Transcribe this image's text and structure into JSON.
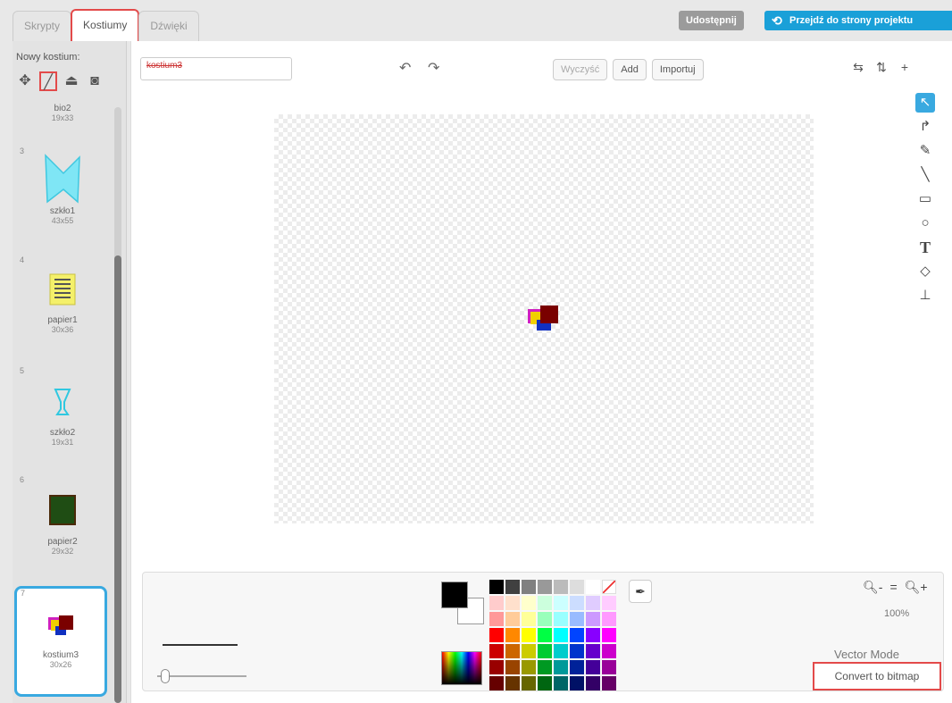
{
  "tabs": [
    {
      "label": "Skrypty"
    },
    {
      "label": "Kostiumy"
    },
    {
      "label": "Dźwięki"
    }
  ],
  "header": {
    "share_label": "Udostępnij",
    "project_page_label": "Przejdź do strony projektu",
    "project_page_icon": "sync-arrows-icon"
  },
  "sidebar": {
    "new_costume_label": "Nowy kostium:",
    "tools": [
      {
        "icon": "paintbrush-icon"
      },
      {
        "icon": "paint-new-icon"
      },
      {
        "icon": "upload-icon"
      },
      {
        "icon": "camera-icon"
      }
    ],
    "costumes": [
      {
        "num": "",
        "name": "bio2",
        "size": "19x33"
      },
      {
        "num": "3",
        "name": "szkło1",
        "size": "43x55"
      },
      {
        "num": "4",
        "name": "papier1",
        "size": "30x36"
      },
      {
        "num": "5",
        "name": "szkło2",
        "size": "19x31"
      },
      {
        "num": "6",
        "name": "papier2",
        "size": "29x32"
      },
      {
        "num": "7",
        "name": "kostium3",
        "size": "30x26"
      }
    ]
  },
  "editor": {
    "costume_name": "kostium3",
    "clear_label": "Wyczyść",
    "add_label": "Add",
    "import_label": "Importuj",
    "zoom_level": "100%",
    "mode_label": "Vector Mode",
    "convert_label": "Convert to bitmap"
  },
  "palette": [
    "#000000",
    "#404040",
    "#808080",
    "#999999",
    "#bbbbbb",
    "#dddddd",
    "#ffffff",
    "transparent",
    "#ffcccc",
    "#ffe0cc",
    "#ffffcc",
    "#ccffdd",
    "#ccffff",
    "#ccddff",
    "#e0ccff",
    "#ffccff",
    "#ff9999",
    "#ffcc99",
    "#ffff99",
    "#99ffbb",
    "#99ffff",
    "#99bbff",
    "#cc99ff",
    "#ff99ff",
    "#ff0000",
    "#ff8800",
    "#ffff00",
    "#00ff44",
    "#00ffff",
    "#0044ff",
    "#8800ff",
    "#ff00ff",
    "#cc0000",
    "#cc6600",
    "#cccc00",
    "#00cc33",
    "#00cccc",
    "#0033cc",
    "#6600cc",
    "#cc00cc",
    "#990000",
    "#994400",
    "#999900",
    "#009922",
    "#009999",
    "#002299",
    "#440099",
    "#990099",
    "#660000",
    "#663300",
    "#666600",
    "#006611",
    "#006666",
    "#001166",
    "#330066",
    "#660066"
  ]
}
